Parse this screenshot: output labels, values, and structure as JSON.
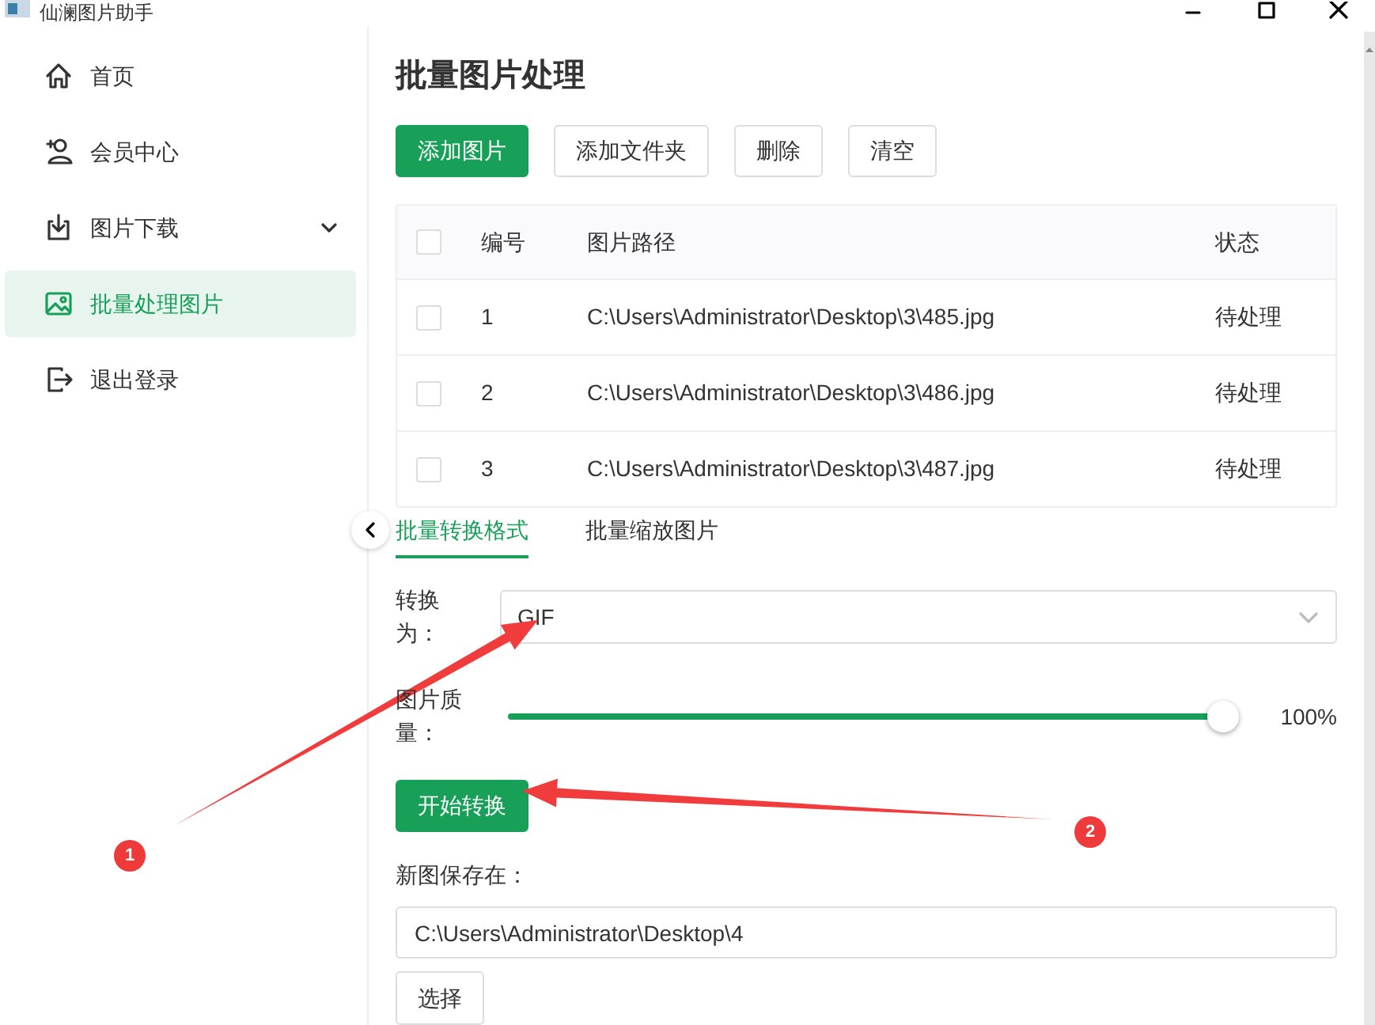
{
  "window": {
    "title": "仙澜图片助手"
  },
  "sidebar": {
    "items": [
      {
        "label": "首页",
        "kind": "home",
        "selected": false
      },
      {
        "label": "会员中心",
        "kind": "member",
        "selected": false
      },
      {
        "label": "图片下载",
        "kind": "download",
        "selected": false,
        "expanded": false
      },
      {
        "label": "批量处理图片",
        "kind": "image",
        "selected": true
      },
      {
        "label": "退出登录",
        "kind": "logout",
        "selected": false
      }
    ]
  },
  "page_title": "批量图片处理",
  "toolbar": [
    {
      "label": "添加图片",
      "primary": true
    },
    {
      "label": "添加文件夹",
      "primary": false
    },
    {
      "label": "删除",
      "primary": false
    },
    {
      "label": "清空",
      "primary": false
    }
  ],
  "table": {
    "header_checked": false,
    "columns": [
      "编号",
      "图片路径",
      "状态"
    ],
    "rows": [
      {
        "checked": false,
        "cells": [
          "1",
          "C:\\Users\\Administrator\\Desktop\\3\\485.jpg",
          "待处理"
        ]
      },
      {
        "checked": false,
        "cells": [
          "2",
          "C:\\Users\\Administrator\\Desktop\\3\\486.jpg",
          "待处理"
        ]
      },
      {
        "checked": false,
        "cells": [
          "3",
          "C:\\Users\\Administrator\\Desktop\\3\\487.jpg",
          "待处理"
        ]
      }
    ]
  },
  "tabs": [
    {
      "label": "批量转换格式",
      "selected": true
    },
    {
      "label": "批量缩放图片",
      "selected": false
    }
  ],
  "convert": {
    "label": "转换为：",
    "value": "GIF"
  },
  "quality": {
    "label": "图片质量：",
    "level": 1.0,
    "reading": "100%"
  },
  "start_button": "开始转换",
  "save": {
    "label": "新图保存在：",
    "value": "C:\\Users\\Administrator\\Desktop\\4",
    "button": "选择"
  },
  "annotations": [
    {
      "number": "1"
    },
    {
      "number": "2"
    }
  ]
}
